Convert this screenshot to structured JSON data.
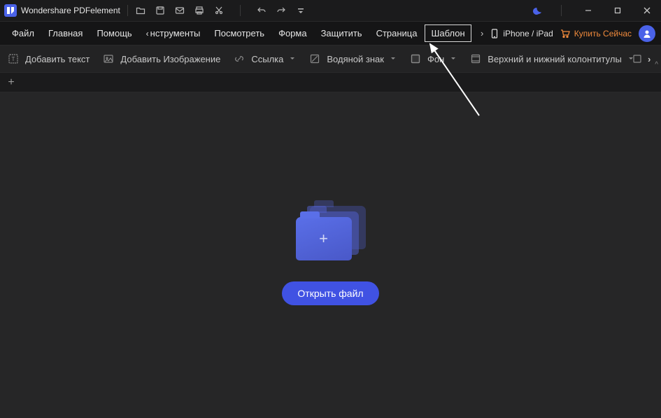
{
  "app": {
    "title": "Wondershare PDFelement"
  },
  "titlebar_icons": [
    "folder",
    "save",
    "mail",
    "print",
    "cut",
    "divider",
    "undo",
    "redo",
    "dropdown"
  ],
  "window_controls": [
    "minimize",
    "maximize",
    "close"
  ],
  "menu": {
    "items": [
      "Файл",
      "Главная",
      "Помощь",
      "нструменты",
      "Посмотреть",
      "Форма",
      "Защитить",
      "Страница",
      "Шаблон"
    ],
    "highlighted_index": 8,
    "iphone_label": "iPhone / iPad",
    "buy_label": "Купить Сейчас"
  },
  "toolbar": {
    "add_text": "Добавить текст",
    "add_image": "Добавить Изображение",
    "link": "Ссылка",
    "watermark": "Водяной знак",
    "background": "Фон",
    "header_footer": "Верхний и нижний колонтитулы"
  },
  "workspace": {
    "open_file": "Открыть файл"
  }
}
